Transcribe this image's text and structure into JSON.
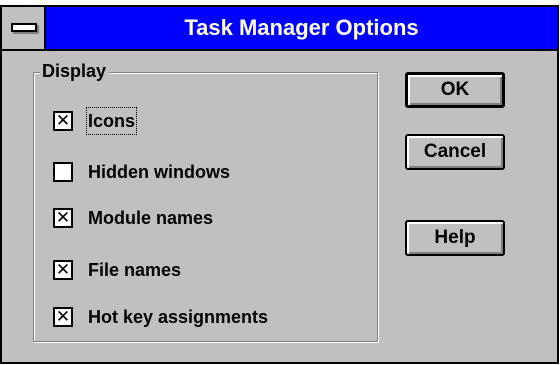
{
  "window": {
    "title": "Task Manager Options",
    "titlebar_color": "#0000ff",
    "face_color": "#c0c0c0",
    "system_menu_icon": "system-menu-icon"
  },
  "display_group": {
    "label": "Display",
    "options": [
      {
        "label": "Icons",
        "checked": true,
        "check_mark": "✕"
      },
      {
        "label": "Hidden windows",
        "checked": false,
        "check_mark": ""
      },
      {
        "label": "Module names",
        "checked": true,
        "check_mark": "✕"
      },
      {
        "label": "File names",
        "checked": true,
        "check_mark": "✕"
      },
      {
        "label": "Hot key assignments",
        "checked": true,
        "check_mark": "✕"
      }
    ]
  },
  "buttons": {
    "ok": "OK",
    "cancel": "Cancel",
    "help": "Help"
  }
}
